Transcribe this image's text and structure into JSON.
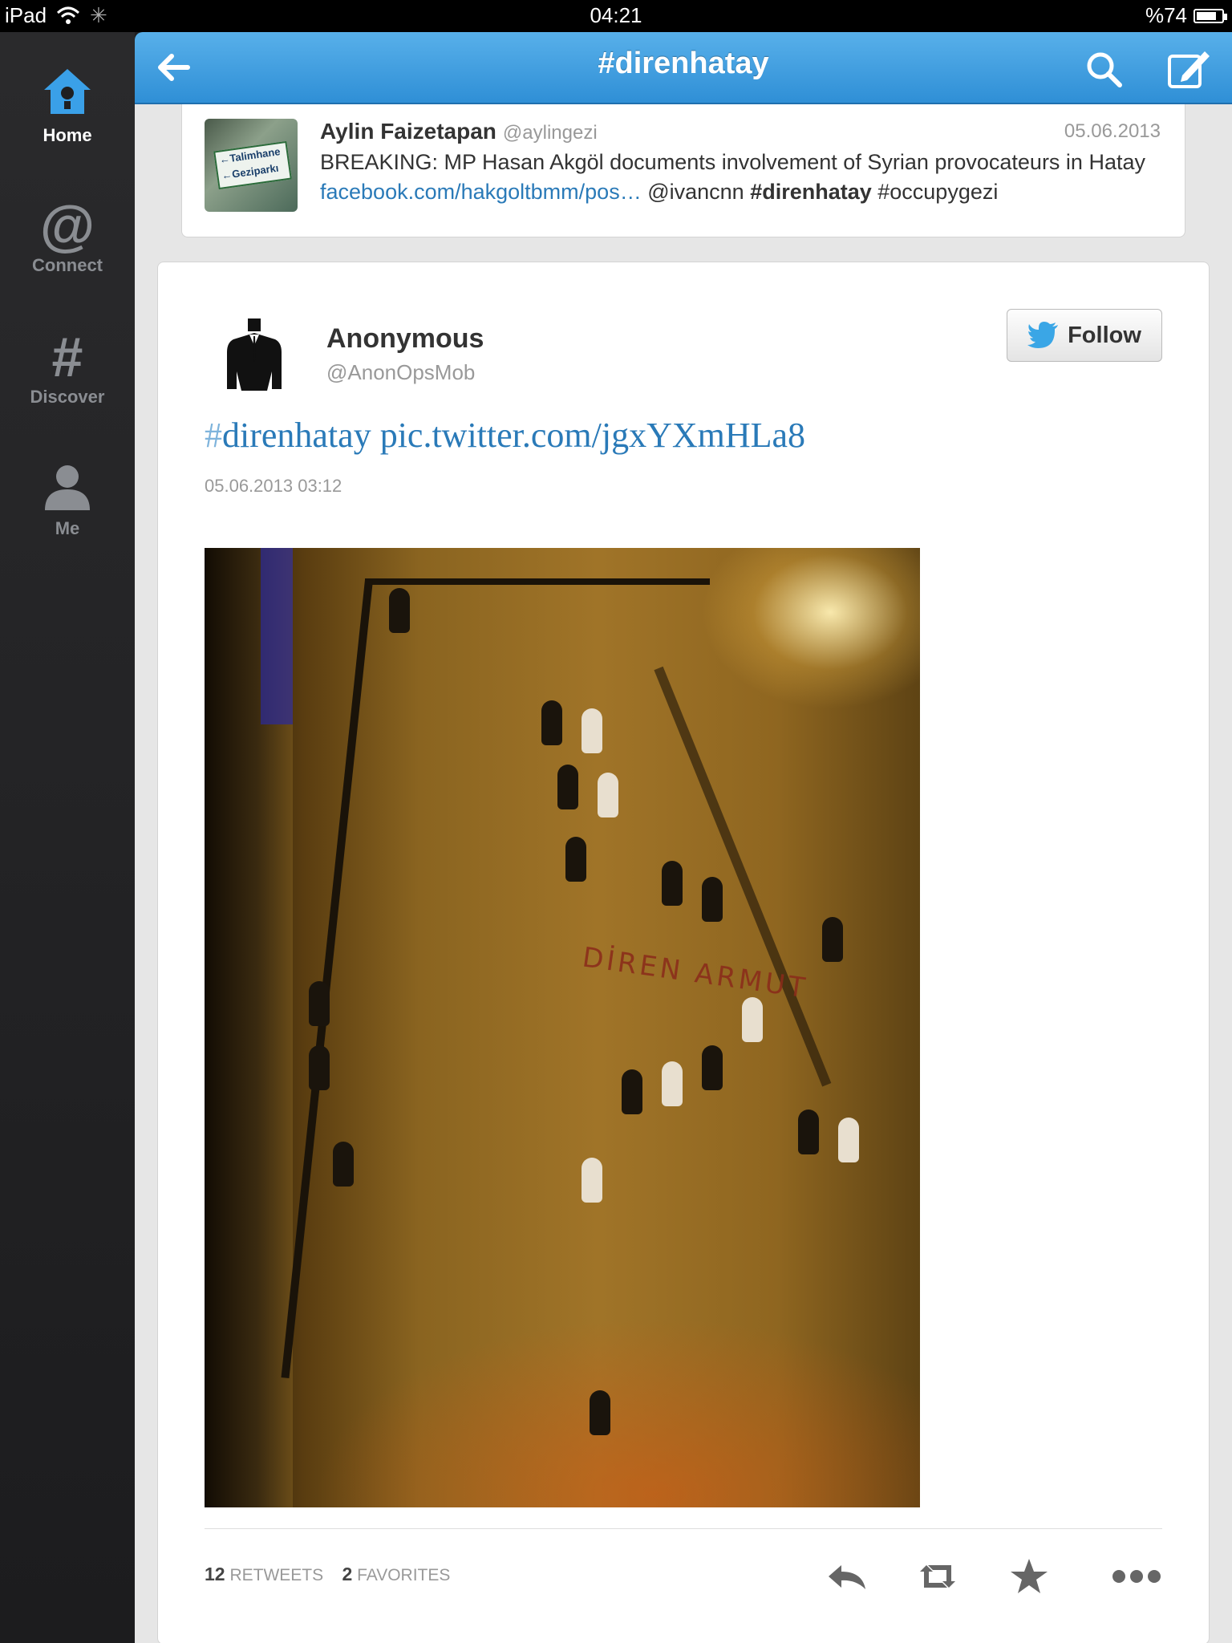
{
  "status_bar": {
    "device": "iPad",
    "time": "04:21",
    "battery": "%74"
  },
  "sidebar": {
    "items": [
      {
        "label": "Home",
        "icon": "home-icon",
        "active": true
      },
      {
        "label": "Connect",
        "icon": "at-icon",
        "active": false
      },
      {
        "label": "Discover",
        "icon": "hash-icon",
        "active": false
      },
      {
        "label": "Me",
        "icon": "person-icon",
        "active": false
      }
    ]
  },
  "header": {
    "title": "#direnhatay"
  },
  "previous_tweet": {
    "name": "Aylin Faizetapan",
    "handle": "@aylingezi",
    "date": "05.06.2013",
    "text_prefix": "BREAKING: MP Hasan Akgöl documents involvement of Syrian provocateurs in Hatay ",
    "link": "facebook.com/hakgoltbmm/pos…",
    "mention": " @ivancnn ",
    "hashtag": "#direnhatay",
    "hashtag2": " #occupygezi",
    "thumb_text": [
      "←Talimhane",
      "←Geziparkı"
    ]
  },
  "tweet": {
    "name": "Anonymous",
    "handle": "@AnonOpsMob",
    "follow_label": "Follow",
    "hash_symbol": "#",
    "hashtag": "direnhatay",
    "pic_link": " pic.twitter.com/jgxYXmHLa8",
    "timestamp": "05.06.2013 03:12",
    "graffiti": "DİREN ARMUT",
    "retweets_count": "12",
    "retweets_label": "RETWEETS",
    "favorites_count": "2",
    "favorites_label": "FAVORITES"
  },
  "colors": {
    "accent": "#2f8fd6",
    "link": "#2a7ab8",
    "sidebar_bg": "#1f1f21"
  }
}
